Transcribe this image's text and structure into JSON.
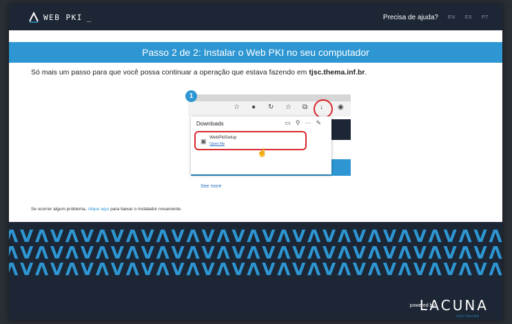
{
  "header": {
    "logo_text": "WEB PKI",
    "logo_cursor": "_",
    "help_link": "Precisa de ajuda?",
    "languages": [
      "EN",
      "ES",
      "PT"
    ]
  },
  "banner": {
    "title": "Passo 2 de 2: Instalar o Web PKI no seu computador"
  },
  "intro": {
    "text_before": "Só mais um passo para que você possa continuar a operação que estava fazendo em ",
    "domain": "tjsc.thema.inf.br",
    "text_after": "."
  },
  "illustration": {
    "step_number": "1",
    "downloads_title": "Downloads",
    "file_name": "WebPkiSetup",
    "open_file_label": "Open file",
    "see_more_label": "See more",
    "toolbar_icons": [
      "tab-icon",
      "circle-icon",
      "refresh-icon",
      "favorites-icon",
      "collections-icon",
      "download-icon",
      "profile-icon"
    ],
    "panel_icons": [
      "folder-icon",
      "search-icon",
      "more-icon",
      "pin-icon"
    ]
  },
  "problem": {
    "text_before": "Se ocorrer algum problema, ",
    "link": "clique aqui",
    "text_after": " para baixar o instalador novamente."
  },
  "footer": {
    "pattern": "ΛVΛVΛVΛVΛVΛVΛVΛVΛVΛVΛVΛVΛVΛVΛVΛVΛVΛVΛVΛVΛVΛVΛV",
    "powered_by": "powered by",
    "brand": "LACUNA",
    "brand_sub": "SOFTWARE"
  },
  "colors": {
    "navy": "#1c2634",
    "accent_blue": "#2d96d3",
    "highlight_red": "#d9262b"
  }
}
